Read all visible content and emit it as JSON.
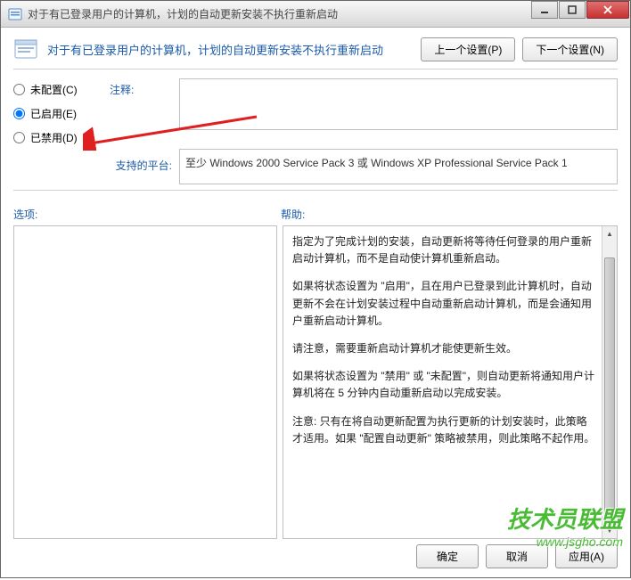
{
  "window": {
    "title": "对于有已登录用户的计算机，计划的自动更新安装不执行重新启动"
  },
  "header": {
    "title": "对于有已登录用户的计算机，计划的自动更新安装不执行重新启动",
    "prev_button": "上一个设置(P)",
    "next_button": "下一个设置(N)"
  },
  "radios": {
    "not_configured": "未配置(C)",
    "enabled": "已启用(E)",
    "disabled": "已禁用(D)",
    "selected": "enabled"
  },
  "labels": {
    "comment": "注释:",
    "platforms": "支持的平台:",
    "options": "选项:",
    "help": "帮助:"
  },
  "platforms_text": "至少 Windows 2000 Service Pack 3 或 Windows XP Professional Service Pack 1",
  "help_paragraphs": [
    "指定为了完成计划的安装，自动更新将等待任何登录的用户重新启动计算机，而不是自动使计算机重新启动。",
    "如果将状态设置为 \"启用\"，且在用户已登录到此计算机时，自动更新不会在计划安装过程中自动重新启动计算机，而是会通知用户重新启动计算机。",
    "请注意，需要重新启动计算机才能使更新生效。",
    "如果将状态设置为 \"禁用\" 或 \"未配置\"，则自动更新将通知用户计算机将在 5 分钟内自动重新启动以完成安装。",
    "注意: 只有在将自动更新配置为执行更新的计划安装时，此策略才适用。如果 \"配置自动更新\" 策略被禁用，则此策略不起作用。"
  ],
  "buttons": {
    "ok": "确定",
    "cancel": "取消",
    "apply": "应用(A)"
  },
  "watermark": {
    "main": "技术员联盟",
    "url": "www.jsgho.com"
  }
}
